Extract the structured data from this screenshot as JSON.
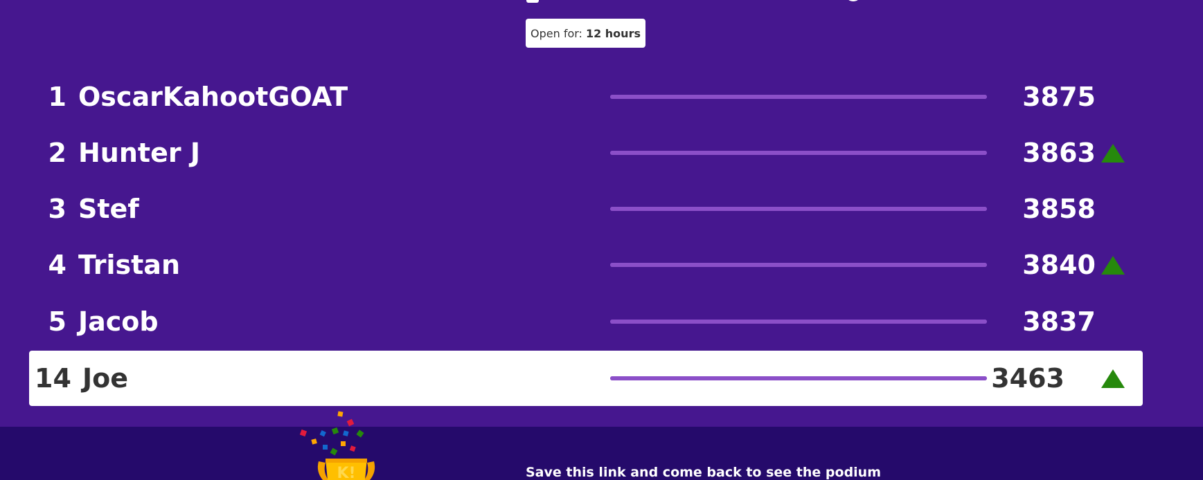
{
  "badge": {
    "label": "Open for:",
    "value": "12 hours"
  },
  "leaderboard": [
    {
      "rank": "1",
      "name": "OscarKahootGOAT",
      "score": "3875",
      "trend": "none"
    },
    {
      "rank": "2",
      "name": "Hunter J",
      "score": "3863",
      "trend": "up"
    },
    {
      "rank": "3",
      "name": "Stef",
      "score": "3858",
      "trend": "none"
    },
    {
      "rank": "4",
      "name": "Tristan",
      "score": "3840",
      "trend": "up"
    },
    {
      "rank": "5",
      "name": "Jacob",
      "score": "3837",
      "trend": "none"
    }
  ],
  "current_player": {
    "rank": "14",
    "name": "Joe",
    "score": "3463",
    "trend": "up"
  },
  "footer": {
    "save_text": "Save this link and come back to see the podium",
    "trophy_icon": "trophy-icon"
  },
  "colors": {
    "background": "#46178f",
    "footer": "#250a6b",
    "bar": "#8b4fc8",
    "trend_up": "#26890c",
    "highlight_row": "#ffffff"
  }
}
